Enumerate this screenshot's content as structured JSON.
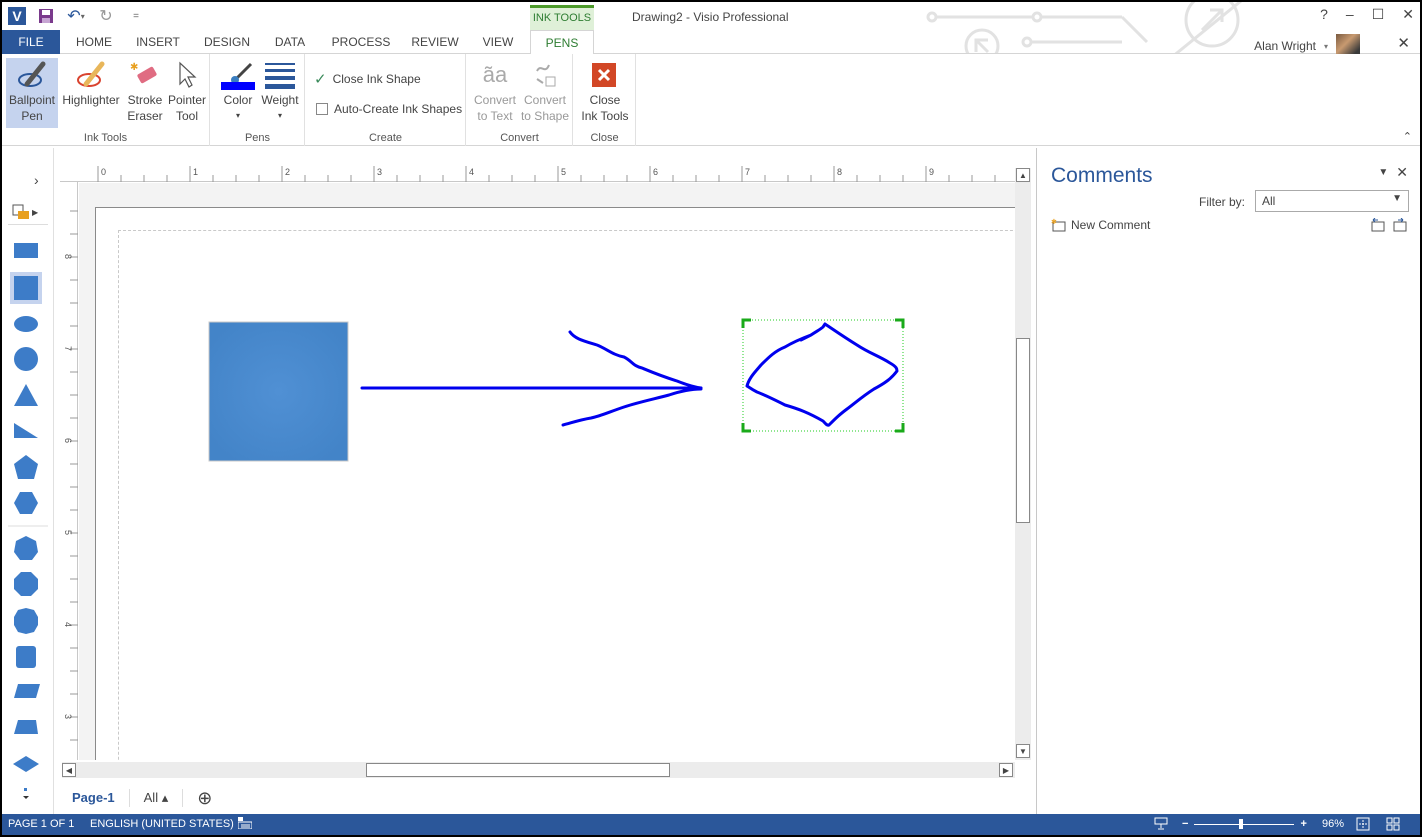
{
  "app": {
    "title": "Drawing2 - Visio Professional",
    "logo_label": "V",
    "user_name": "Alan Wright"
  },
  "qat": {
    "icons": [
      "visio-logo",
      "save-icon",
      "undo-icon",
      "redo-icon",
      "customize-qat-icon"
    ]
  },
  "window_controls": {
    "help": "?",
    "minimize": "–",
    "maximize": "☐",
    "close": "✕"
  },
  "contextual_tab": "INK TOOLS",
  "tabs": [
    {
      "label": "FILE"
    },
    {
      "label": "HOME"
    },
    {
      "label": "INSERT"
    },
    {
      "label": "DESIGN"
    },
    {
      "label": "DATA"
    },
    {
      "label": "PROCESS"
    },
    {
      "label": "REVIEW"
    },
    {
      "label": "VIEW"
    },
    {
      "label": "PENS",
      "active": true
    }
  ],
  "ribbon": {
    "groups": [
      {
        "label": "Ink Tools",
        "buttons": [
          {
            "line1": "Ballpoint",
            "line2": "Pen",
            "selected": true
          },
          {
            "line1": "Highlighter",
            "line2": ""
          },
          {
            "line1": "Stroke",
            "line2": "Eraser"
          },
          {
            "line1": "Pointer",
            "line2": "Tool"
          }
        ]
      },
      {
        "label": "Pens",
        "buttons": [
          {
            "line1": "Color",
            "line2": "▾"
          },
          {
            "line1": "Weight",
            "line2": "▾"
          }
        ]
      },
      {
        "label": "Create",
        "checks": [
          {
            "label": "Close Ink Shape",
            "checked": true
          },
          {
            "label": "Auto-Create Ink Shapes",
            "checked": false
          }
        ]
      },
      {
        "label": "Convert",
        "buttons": [
          {
            "line1": "Convert",
            "line2": "to Text",
            "disabled": true
          },
          {
            "line1": "Convert",
            "line2": "to Shape",
            "disabled": true
          }
        ]
      },
      {
        "label": "Close",
        "buttons": [
          {
            "line1": "Close",
            "line2": "Ink Tools"
          }
        ]
      }
    ],
    "pen_color": "#0000ff"
  },
  "shapes_panel": {
    "expand": "›",
    "items": [
      "rectangle",
      "square",
      "ellipse",
      "circle",
      "triangle",
      "right-triangle",
      "pentagon",
      "hexagon",
      "heptagon",
      "octagon",
      "decagon",
      "can",
      "parallelogram",
      "trapezoid",
      "diamond"
    ],
    "selected": "square"
  },
  "rulers": {
    "horizontal": [
      "0",
      "1",
      "2",
      "3",
      "4",
      "5",
      "6",
      "7",
      "8",
      "9"
    ],
    "vertical": [
      "8",
      "7",
      "6",
      "5",
      "4",
      "3"
    ]
  },
  "drawing": {
    "shape_color": "#4a8ad0",
    "ink_color": "#0000ee",
    "selection_color": "#22bb22"
  },
  "page_tabs": {
    "pages": [
      {
        "label": "Page-1",
        "active": true
      }
    ],
    "all_label": "All ▴",
    "add_icon": "⊕"
  },
  "comments": {
    "title": "Comments",
    "filter_label": "Filter by:",
    "filter_value": "All",
    "new_comment": "New Comment"
  },
  "status": {
    "page": "PAGE 1 OF 1",
    "language": "ENGLISH (UNITED STATES)",
    "zoom_level": "96%",
    "zoom_fraction": 0.45
  },
  "colors": {
    "accent": "#2b579a",
    "contextual": "#4c9a2a"
  }
}
